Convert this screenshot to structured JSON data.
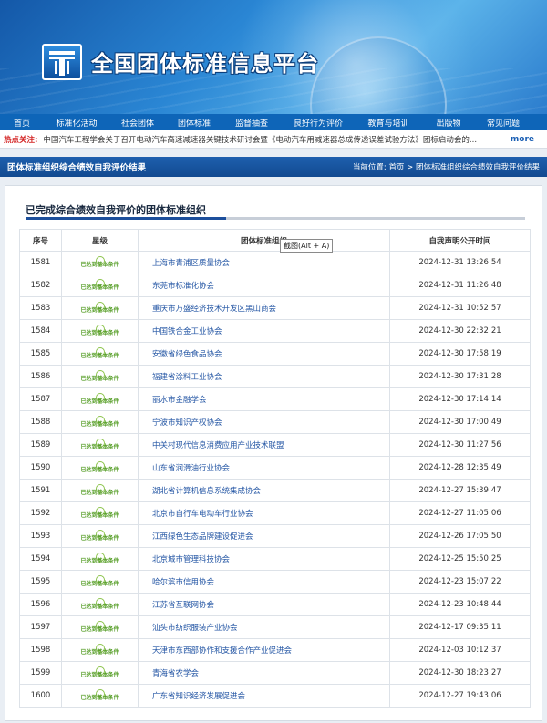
{
  "header": {
    "site_title": "全国团体标准信息平台",
    "logo_icon": "platform-logo-icon"
  },
  "nav": {
    "items": [
      "首页",
      "标准化活动",
      "社会团体",
      "团体标准",
      "监督抽查",
      "良好行为评价",
      "教育与培训",
      "出版物",
      "常见问题"
    ]
  },
  "ticker": {
    "label": "热点关注:",
    "text": "中国汽车工程学会关于召开电动汽车高速减速器关键技术研讨会暨《电动汽车用减速器总成传递误差试验方法》团标启动会的...",
    "more": "more"
  },
  "section": {
    "title": "团体标准组织综合绩效自我评价结果",
    "breadcrumb": "当前位置:  首页 > 团体标准组织综合绩效自我评价结果"
  },
  "panel": {
    "title": "已完成综合绩效自我评价的团体标准组织"
  },
  "tooltip": "截图(Alt + A)",
  "table": {
    "headers": [
      "序号",
      "星级",
      "团体标准组织",
      "自我声明公开时间"
    ],
    "badge_text": "已达到基本条件",
    "rows": [
      {
        "no": "1581",
        "org": "上海市青浦区质量协会",
        "time": "2024-12-31 13:26:54"
      },
      {
        "no": "1582",
        "org": "东莞市标准化协会",
        "time": "2024-12-31 11:26:48"
      },
      {
        "no": "1583",
        "org": "重庆市万盛经济技术开发区黑山商会",
        "time": "2024-12-31 10:52:57"
      },
      {
        "no": "1584",
        "org": "中国铁合金工业协会",
        "time": "2024-12-30 22:32:21"
      },
      {
        "no": "1585",
        "org": "安徽省绿色食品协会",
        "time": "2024-12-30 17:58:19"
      },
      {
        "no": "1586",
        "org": "福建省涂料工业协会",
        "time": "2024-12-30 17:31:28"
      },
      {
        "no": "1587",
        "org": "丽水市金融学会",
        "time": "2024-12-30 17:14:14"
      },
      {
        "no": "1588",
        "org": "宁波市知识产权协会",
        "time": "2024-12-30 17:00:49"
      },
      {
        "no": "1589",
        "org": "中关村现代信息消费应用产业技术联盟",
        "time": "2024-12-30 11:27:56"
      },
      {
        "no": "1590",
        "org": "山东省润滑油行业协会",
        "time": "2024-12-28 12:35:49"
      },
      {
        "no": "1591",
        "org": "湖北省计算机信息系统集成协会",
        "time": "2024-12-27 15:39:47"
      },
      {
        "no": "1592",
        "org": "北京市自行车电动车行业协会",
        "time": "2024-12-27 11:05:06"
      },
      {
        "no": "1593",
        "org": "江西绿色生态品牌建设促进会",
        "time": "2024-12-26 17:05:50"
      },
      {
        "no": "1594",
        "org": "北京城市管理科技协会",
        "time": "2024-12-25 15:50:25"
      },
      {
        "no": "1595",
        "org": "哈尔滨市信用协会",
        "time": "2024-12-23 15:07:22"
      },
      {
        "no": "1596",
        "org": "江苏省互联网协会",
        "time": "2024-12-23 10:48:44"
      },
      {
        "no": "1597",
        "org": "汕头市纺织服装产业协会",
        "time": "2024-12-17 09:35:11"
      },
      {
        "no": "1598",
        "org": "天津市东西部协作和支援合作产业促进会",
        "time": "2024-12-03 10:12:37"
      },
      {
        "no": "1599",
        "org": "青海省农学会",
        "time": "2024-12-30 18:23:27"
      },
      {
        "no": "1600",
        "org": "广东省知识经济发展促进会",
        "time": "2024-12-27 19:43:06"
      }
    ]
  }
}
